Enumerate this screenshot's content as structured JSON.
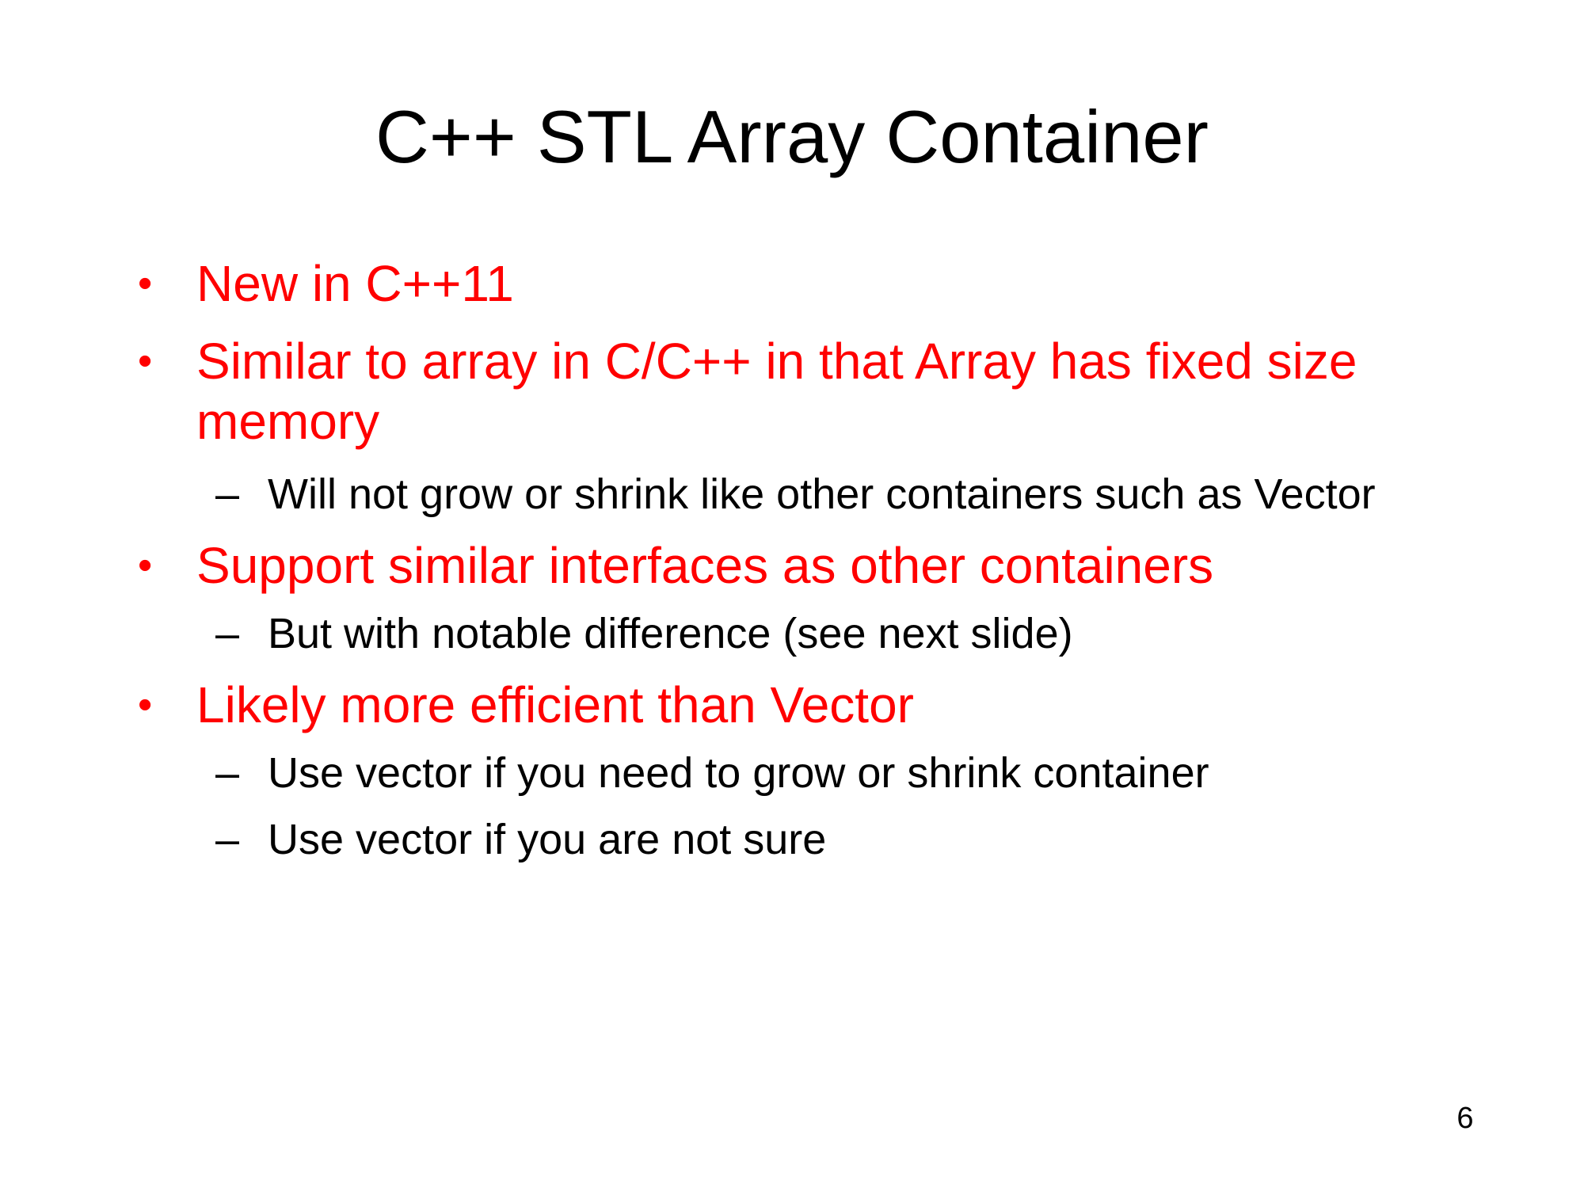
{
  "slide": {
    "title": "C++ STL Array Container",
    "page_number": "6",
    "bullet_marker": "•",
    "sub_marker": "–",
    "items": [
      {
        "text": "New in C++11"
      },
      {
        "text": "Similar to array in C/C++ in that Array has fixed size memory",
        "sub": [
          "Will not grow or shrink like other containers such as Vector"
        ]
      },
      {
        "text": "Support similar interfaces as other containers",
        "sub": [
          "But with notable difference (see next slide)"
        ]
      },
      {
        "text": "Likely more efficient than Vector",
        "sub": [
          "Use vector if you need to grow or shrink container",
          "Use vector if you are not sure"
        ]
      }
    ],
    "colors": {
      "bullet_text": "#ff0000",
      "sub_text": "#000000",
      "background": "#ffffff"
    }
  }
}
